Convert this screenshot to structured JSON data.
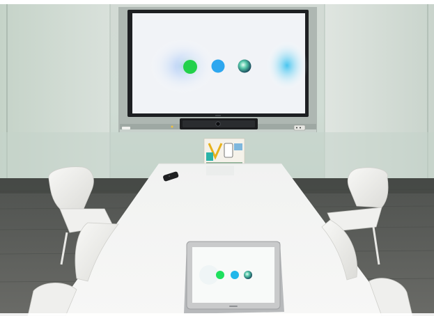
{
  "scene": {
    "type": "photo",
    "colors": {
      "wall": "#d5ddd6",
      "frosted_glass": "#c9d9cf",
      "floor": "#585a56",
      "table": "#f4f4f2",
      "chair": "#f3f3f1",
      "tv_screen": "#f1f3f7",
      "call_button": "#22d14a",
      "second_button": "#2ea7ef",
      "third_button": "#2a7f7e"
    }
  },
  "tv_screen": {
    "clock": "",
    "prompt": "",
    "sub_prompt": "",
    "buttons": [
      {
        "icon": "call-icon",
        "label": ""
      },
      {
        "icon": "share-icon",
        "label": ""
      },
      {
        "icon": "assistant-icon",
        "label": ""
      }
    ]
  },
  "touch_panel": {
    "buttons": [
      {
        "icon": "call-icon"
      },
      {
        "icon": "share-icon"
      },
      {
        "icon": "assistant-icon"
      }
    ]
  }
}
